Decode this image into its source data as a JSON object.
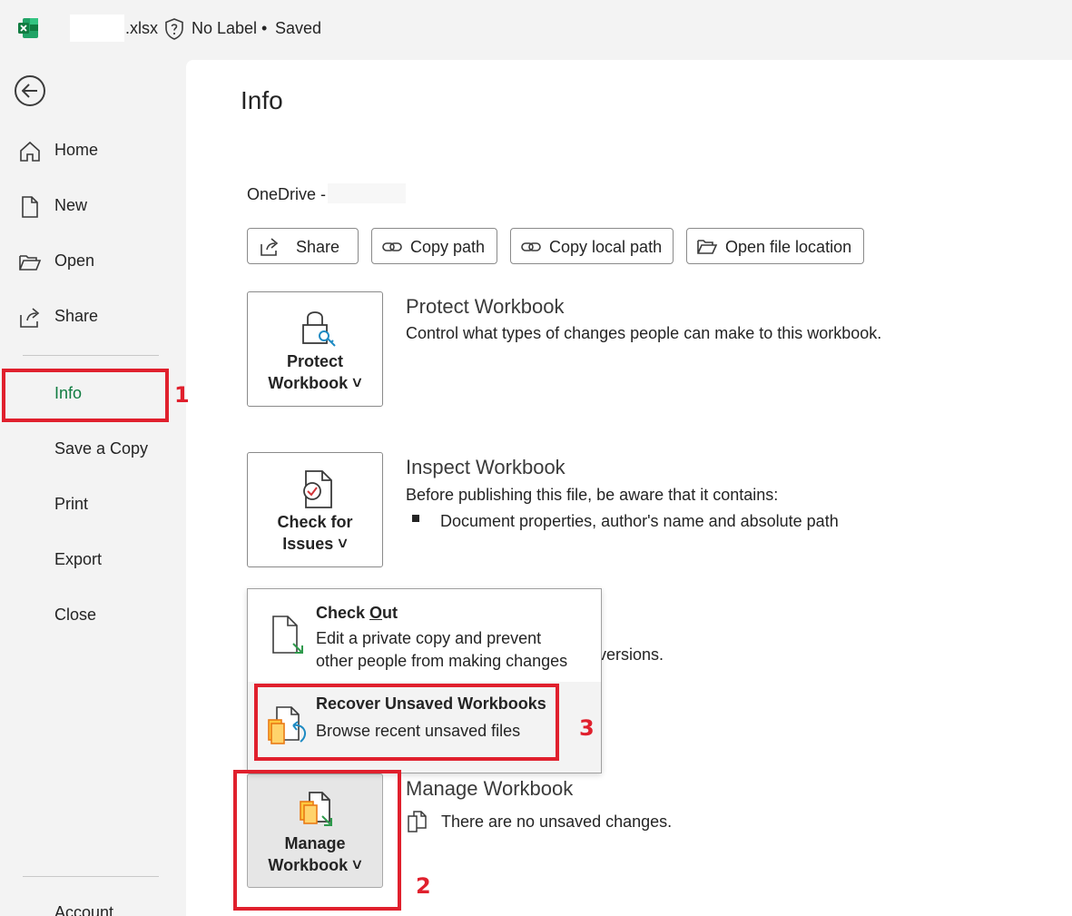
{
  "titlebar": {
    "file_ext": ".xlsx",
    "sensitivity_label": "No Label",
    "separator": "•",
    "save_status": "Saved"
  },
  "sidebar": {
    "items": [
      {
        "label": "Home",
        "icon": "home-icon"
      },
      {
        "label": "New",
        "icon": "new-document-icon"
      },
      {
        "label": "Open",
        "icon": "folder-open-icon"
      },
      {
        "label": "Share",
        "icon": "share-icon"
      },
      {
        "label": "Info",
        "active": true
      },
      {
        "label": "Save a Copy"
      },
      {
        "label": "Print"
      },
      {
        "label": "Export"
      },
      {
        "label": "Close"
      },
      {
        "label": "Account"
      }
    ]
  },
  "main": {
    "title": "Info",
    "location_prefix": "OneDrive -",
    "actions": [
      {
        "label": "Share",
        "icon": "share-icon"
      },
      {
        "label": "Copy path",
        "icon": "link-icon"
      },
      {
        "label": "Copy local path",
        "icon": "link-icon"
      },
      {
        "label": "Open file location",
        "icon": "folder-open-icon"
      }
    ],
    "protect": {
      "button_line1": "Protect",
      "button_line2": "Workbook ˅",
      "heading": "Protect Workbook",
      "description": "Control what types of changes people can make to this workbook."
    },
    "inspect": {
      "button_line1": "Check for",
      "button_line2": "Issues ˅",
      "heading": "Inspect Workbook",
      "description": "Before publishing this file, be aware that it contains:",
      "bullet": "Document properties, author's name and absolute path"
    },
    "versions_fragment": "versions.",
    "manage": {
      "button_line1": "Manage",
      "button_line2": "Workbook ˅",
      "heading": "Manage Workbook",
      "description": "There are no unsaved changes."
    },
    "menu": {
      "items": [
        {
          "title_prefix": "Check ",
          "title_underlined": "O",
          "title_suffix": "ut",
          "desc_line1": "Edit a private copy and prevent",
          "desc_line2": "other people from making changes"
        },
        {
          "title": "Recover Unsaved Workbooks",
          "desc_line1": "Browse recent unsaved files"
        }
      ]
    }
  },
  "annotations": [
    "1",
    "2",
    "3"
  ],
  "colors": {
    "accent_green": "#107c41",
    "annotation_red": "#e0202d"
  }
}
